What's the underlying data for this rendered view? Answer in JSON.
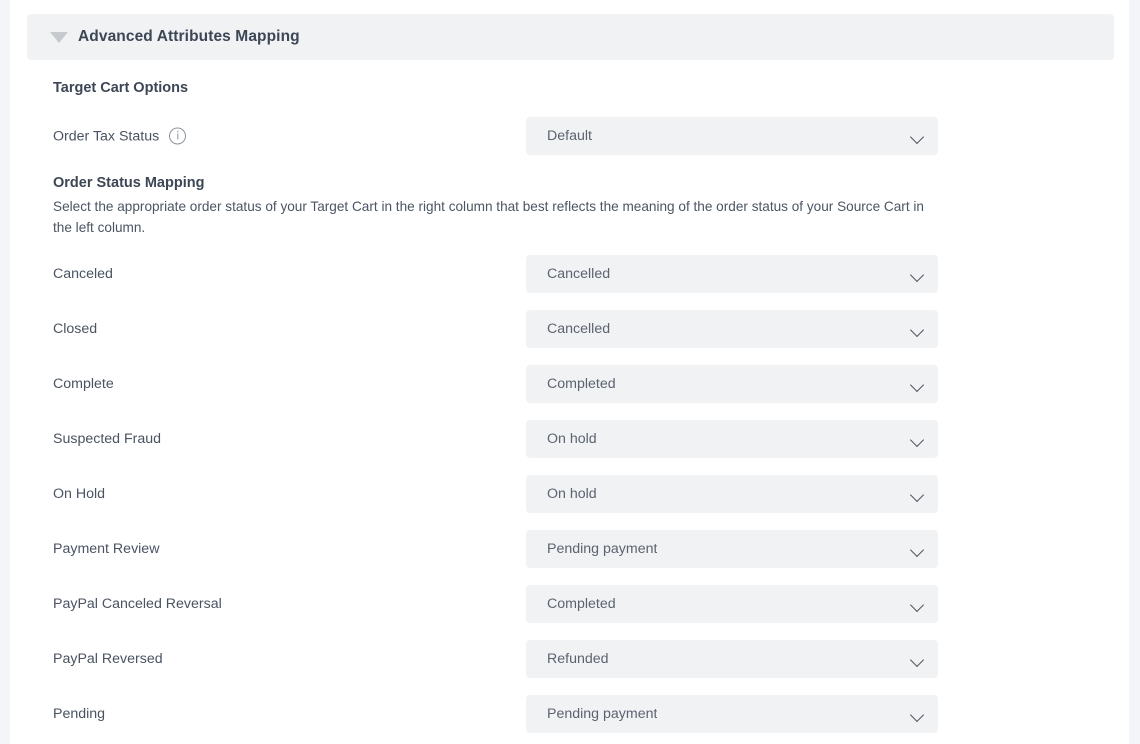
{
  "section": {
    "title": "Advanced Attributes Mapping",
    "caret_icon": "caret-down-icon",
    "expanded": true
  },
  "target_cart_options": {
    "heading": "Target Cart Options",
    "fields": [
      {
        "label": "Order Tax Status",
        "info_icon": "info-icon",
        "value": "Default"
      }
    ]
  },
  "order_status_mapping": {
    "heading": "Order Status Mapping",
    "description": "Select the appropriate order status of your Target Cart in the right column that best reflects the meaning of the order status of your Source Cart in the left column.",
    "rows": [
      {
        "source_status": "Canceled",
        "target_status": "Cancelled"
      },
      {
        "source_status": "Closed",
        "target_status": "Cancelled"
      },
      {
        "source_status": "Complete",
        "target_status": "Completed"
      },
      {
        "source_status": "Suspected Fraud",
        "target_status": "On hold"
      },
      {
        "source_status": "On Hold",
        "target_status": "On hold"
      },
      {
        "source_status": "Payment Review",
        "target_status": "Pending payment"
      },
      {
        "source_status": "PayPal Canceled Reversal",
        "target_status": "Completed"
      },
      {
        "source_status": "PayPal Reversed",
        "target_status": "Refunded"
      },
      {
        "source_status": "Pending",
        "target_status": "Pending payment"
      }
    ]
  },
  "colors": {
    "page_background": "#f4f5f9",
    "card_background": "#ffffff",
    "control_background": "#f1f2f4",
    "heading_text": "#3c4655",
    "body_text": "#4a5361",
    "value_text": "#5c6370"
  }
}
